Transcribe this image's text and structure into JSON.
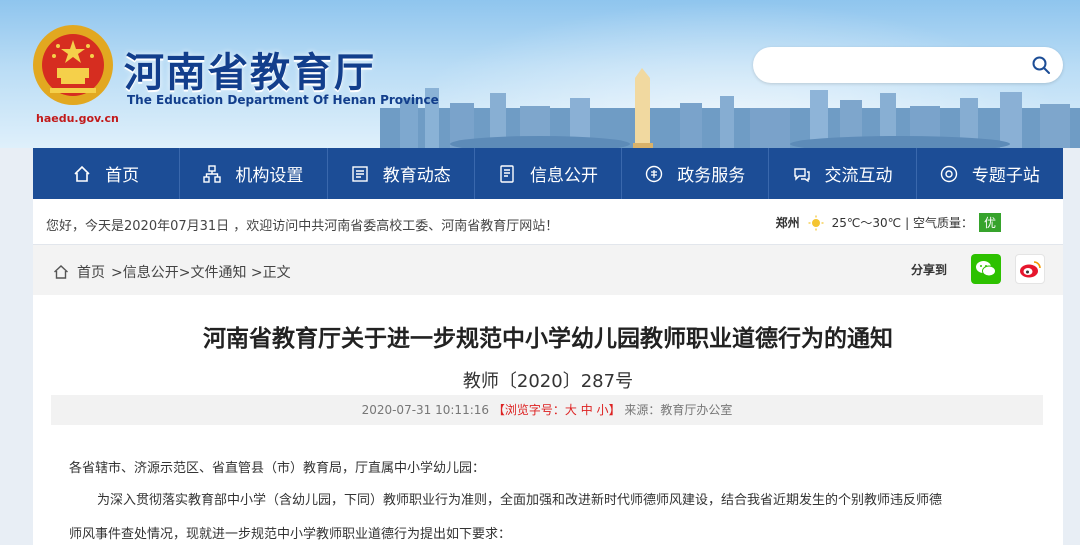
{
  "header": {
    "title": "河南省教育厅",
    "subtitle": "The Education Department Of Henan Province",
    "domain": "haedu.gov.cn",
    "search_placeholder": ""
  },
  "nav": {
    "items": [
      {
        "label": "首页",
        "icon": "home-icon"
      },
      {
        "label": "机构设置",
        "icon": "org-chart-icon"
      },
      {
        "label": "教育动态",
        "icon": "news-icon"
      },
      {
        "label": "信息公开",
        "icon": "document-icon"
      },
      {
        "label": "政务服务",
        "icon": "service-icon"
      },
      {
        "label": "交流互动",
        "icon": "chat-icon"
      },
      {
        "label": "专题子站",
        "icon": "topic-icon"
      }
    ]
  },
  "greeting": {
    "text": "您好，今天是2020年07月31日 ，欢迎访问中共河南省委高校工委、河南省教育厅网站！",
    "city": "郑州",
    "temperature": "25℃～30℃",
    "air_quality_label": "| 空气质量：",
    "air_quality_value": "优"
  },
  "breadcrumb": {
    "home": "首页",
    "path": ">信息公开>文件通知 >正文",
    "share_label": "分享到"
  },
  "article": {
    "title": "河南省教育厅关于进一步规范中小学幼儿园教师职业道德行为的通知",
    "doc_number": "教师〔2020〕287号",
    "date": "2020-07-31 10:11:16",
    "font_size_label": "【浏览字号：",
    "font_large": "大",
    "font_medium": "中",
    "font_small": "小",
    "font_size_close": "】",
    "source": "来源：教育厅办公室",
    "para1": "各省辖市、济源示范区、省直管县（市）教育局，厅直属中小学幼儿园：",
    "para2": "为深入贯彻落实教育部中小学（含幼儿园，下同）教师职业行为准则，全面加强和改进新时代师德师风建设，结合我省近期发生的个别教师违反师德",
    "para3": "师风事件查处情况，现就进一步规范中小学教师职业道德行为提出如下要求："
  }
}
